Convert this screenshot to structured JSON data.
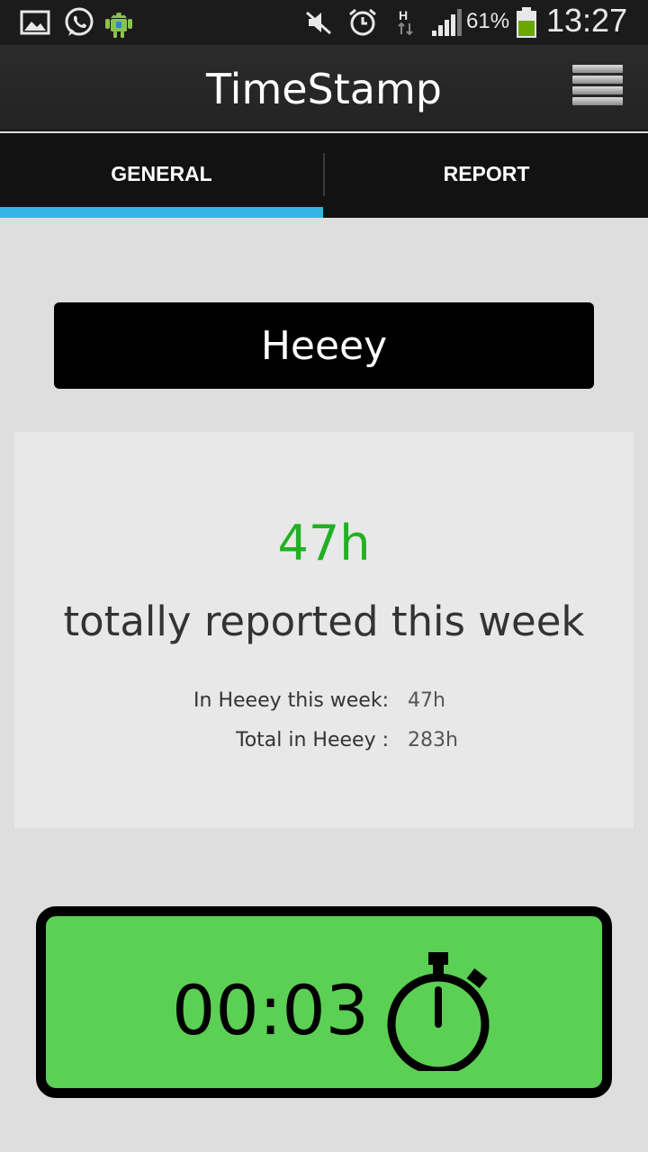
{
  "status_bar": {
    "icons": [
      "gallery-icon",
      "whatsapp-icon",
      "android-icon",
      "mute-icon",
      "alarm-icon",
      "hspa-icon",
      "signal-icon",
      "battery-icon"
    ],
    "battery_percent": "61%",
    "time": "13:27"
  },
  "action_bar": {
    "title": "TimeStamp",
    "menu_icon": "overflow-menu-icon"
  },
  "tabs": [
    {
      "label": "GENERAL",
      "active": true
    },
    {
      "label": "REPORT",
      "active": false
    }
  ],
  "accent_color": "#32b5e5",
  "project": {
    "name": "Heeey"
  },
  "summary": {
    "total_hours": "47h",
    "caption": "totally reported this week",
    "this_week_label": "In Heeey this week:",
    "this_week_value": "47h",
    "total_label": "Total in Heeey :",
    "total_value": "283h",
    "hours_color": "#22b022"
  },
  "timer": {
    "elapsed": "00:03",
    "icon": "stopwatch-icon",
    "color": "#5ccf55"
  }
}
